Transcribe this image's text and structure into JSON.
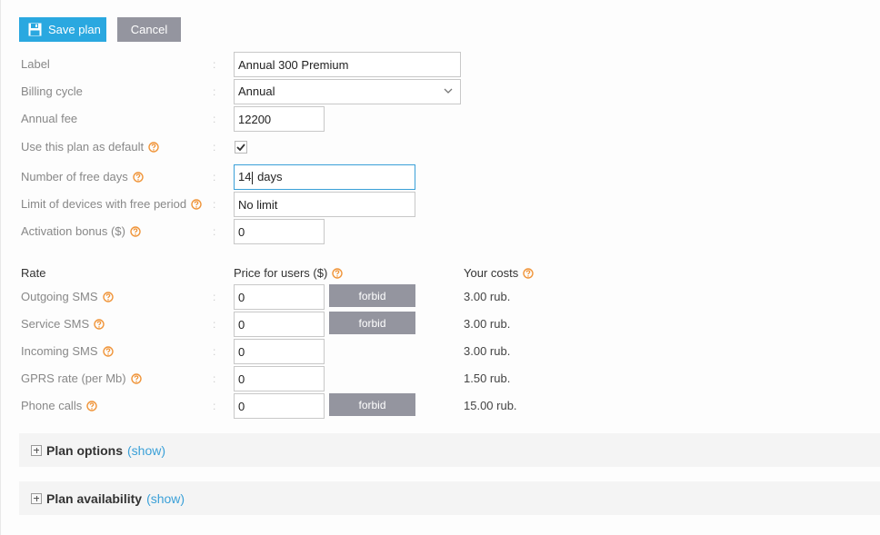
{
  "toolbar": {
    "save_label": "Save plan",
    "save_icon": "floppy-disk-icon",
    "cancel_label": "Cancel"
  },
  "form": {
    "label": {
      "label": "Label",
      "value": "Annual 300 Premium"
    },
    "billing_cycle": {
      "label": "Billing cycle",
      "value": "Annual"
    },
    "annual_fee": {
      "label": "Annual fee",
      "value": "12200"
    },
    "use_default": {
      "label": "Use this plan as default",
      "checked": true
    },
    "free_days": {
      "label": "Number of free days",
      "value_before_caret": "14",
      "value_after_caret": " days"
    },
    "device_limit": {
      "label": "Limit of devices with free period",
      "value": "No limit"
    },
    "activation_bonus": {
      "label": "Activation bonus ($)",
      "value": "0"
    },
    "colon": ":"
  },
  "rates": {
    "headers": {
      "rate": "Rate",
      "price": "Price for users ($)",
      "costs": "Your costs"
    },
    "forbid_label": "forbid",
    "items": [
      {
        "label": "Outgoing SMS",
        "price": "0",
        "forbid": true,
        "cost": "3.00 rub."
      },
      {
        "label": "Service SMS",
        "price": "0",
        "forbid": true,
        "cost": "3.00 rub."
      },
      {
        "label": "Incoming SMS",
        "price": "0",
        "forbid": false,
        "cost": "3.00 rub."
      },
      {
        "label": "GPRS rate (per Mb)",
        "price": "0",
        "forbid": false,
        "cost": "1.50 rub."
      },
      {
        "label": "Phone calls",
        "price": "0",
        "forbid": true,
        "cost": "15.00 rub."
      }
    ]
  },
  "sections": [
    {
      "title": "Plan options",
      "link": "(show)"
    },
    {
      "title": "Plan availability",
      "link": "(show)"
    }
  ],
  "colors": {
    "accent": "#2aa8e0",
    "help": "#f0953a",
    "link": "#3aa0d8",
    "button_gray": "#94959f"
  }
}
